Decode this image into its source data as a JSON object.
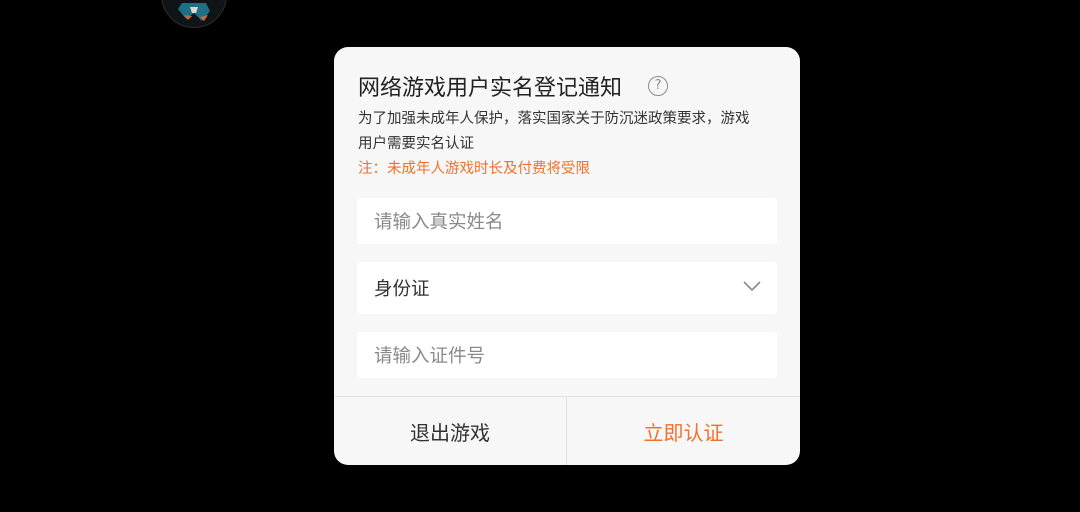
{
  "dialog": {
    "title": "网络游戏用户实名登记通知",
    "help_icon": "question-circle-icon",
    "description": "为了加强未成年人保护，落实国家关于防沉迷政策要求，游戏用户需要实名认证",
    "notice": "注：未成年人游戏时长及付费将受限",
    "name_placeholder": "请输入真实姓名",
    "id_type_value": "身份证",
    "id_number_placeholder": "请输入证件号",
    "exit_label": "退出游戏",
    "verify_label": "立即认证"
  },
  "colors": {
    "background": "#000000",
    "dialog_bg": "#f7f7f7",
    "field_bg": "#ffffff",
    "accent": "#f2702e",
    "text": "#333333",
    "placeholder": "#8a8a8a"
  }
}
